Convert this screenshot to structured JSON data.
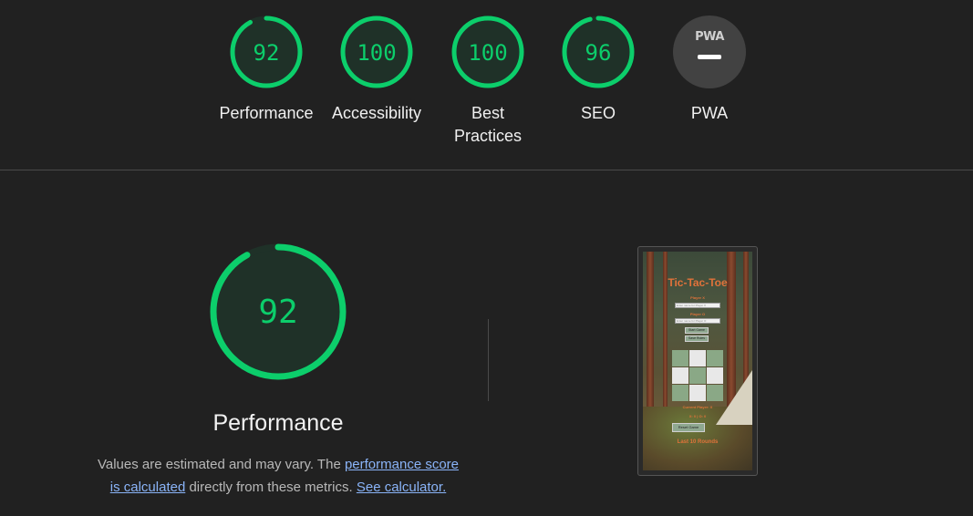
{
  "gauges": [
    {
      "label_line1": "Performance",
      "label_line2": "",
      "score": 92
    },
    {
      "label_line1": "Accessibility",
      "label_line2": "",
      "score": 100
    },
    {
      "label_line1": "Best",
      "label_line2": "Practices",
      "score": 100
    },
    {
      "label_line1": "SEO",
      "label_line2": "",
      "score": 96
    },
    {
      "label_line1": "PWA",
      "label_line2": "",
      "score": null
    }
  ],
  "pwa": {
    "logo_text": "PWA"
  },
  "performance": {
    "score": "92",
    "title": "Performance",
    "desc_prefix": "Values are estimated and may vary. The ",
    "desc_link1": "performance score is calculated",
    "desc_mid": " directly from these metrics. ",
    "desc_link2": "See calculator."
  },
  "screenshot": {
    "app_title": "Tic-Tac-Toe",
    "player_x_label": "Player X",
    "player_x_placeholder": "Enter name for Player X",
    "player_o_label": "Player O",
    "player_o_placeholder": "Enter name for Player O",
    "start_button": "Start Game",
    "save_button": "Save Rules",
    "board": [
      "green",
      "white",
      "green",
      "white",
      "green",
      "white",
      "green",
      "white",
      "green"
    ],
    "current_player": "Current Player: X",
    "score_line": "X: 0 | O: 0",
    "reset_button": "Reset Game",
    "last_rounds": "Last 10 Rounds"
  },
  "colors": {
    "pass": "#0cce6b",
    "pass_bg": "#1f3128",
    "neutral": "#424242",
    "link": "#8ab4f8",
    "background": "#212121"
  }
}
